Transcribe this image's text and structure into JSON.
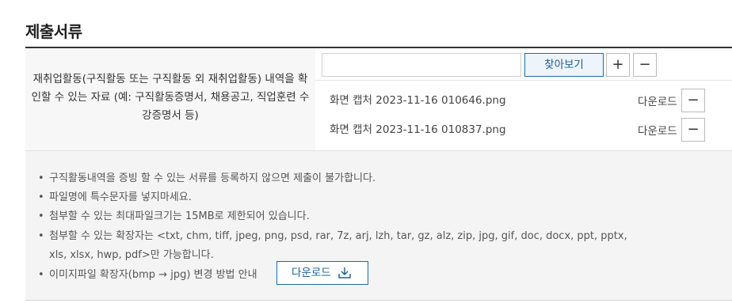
{
  "section": {
    "title": "제출서류"
  },
  "left_label": {
    "line1": "재취업활동(구직활동 또는 구직활동 외 재취업활동) 내역을 확",
    "line2": "인할 수 있는 자료 (예: 구직활동증명서, 채용공고, 직업훈련 수",
    "line3": "강증명서 등)"
  },
  "uploader": {
    "file_input_value": "",
    "find_label": "찾아보기",
    "add_label": "+",
    "remove_label": "−"
  },
  "files": [
    {
      "name": "화면 캡처 2023-11-16 010646.png",
      "download_label": "다운로드",
      "remove_label": "−"
    },
    {
      "name": "화면 캡처 2023-11-16 010837.png",
      "download_label": "다운로드",
      "remove_label": "−"
    }
  ],
  "notes": {
    "bullet": "•",
    "items": [
      "구직활동내역을 증빙 할 수 있는 서류를 등록하지 않으면 제출이 불가합니다.",
      "파일명에 특수문자를 넣지마세요.",
      "첨부할 수 있는 최대파일크기는 15MB로 제한되어 있습니다.",
      "첨부할 수 있는 확장자는 <txt, chm, tiff, jpeg, png, psd, rar, 7z, arj, lzh, tar, gz, alz, zip, jpg, gif, doc, docx, ppt, pptx,",
      "xls, xlsx, hwp, pdf>만 가능합니다.",
      "이미지파일 확장자(bmp → jpg) 변경 방법 안내"
    ],
    "guide_download_label": "다운로드"
  },
  "colors": {
    "accent": "#1b6ba7",
    "panel": "#f4f4f4"
  }
}
